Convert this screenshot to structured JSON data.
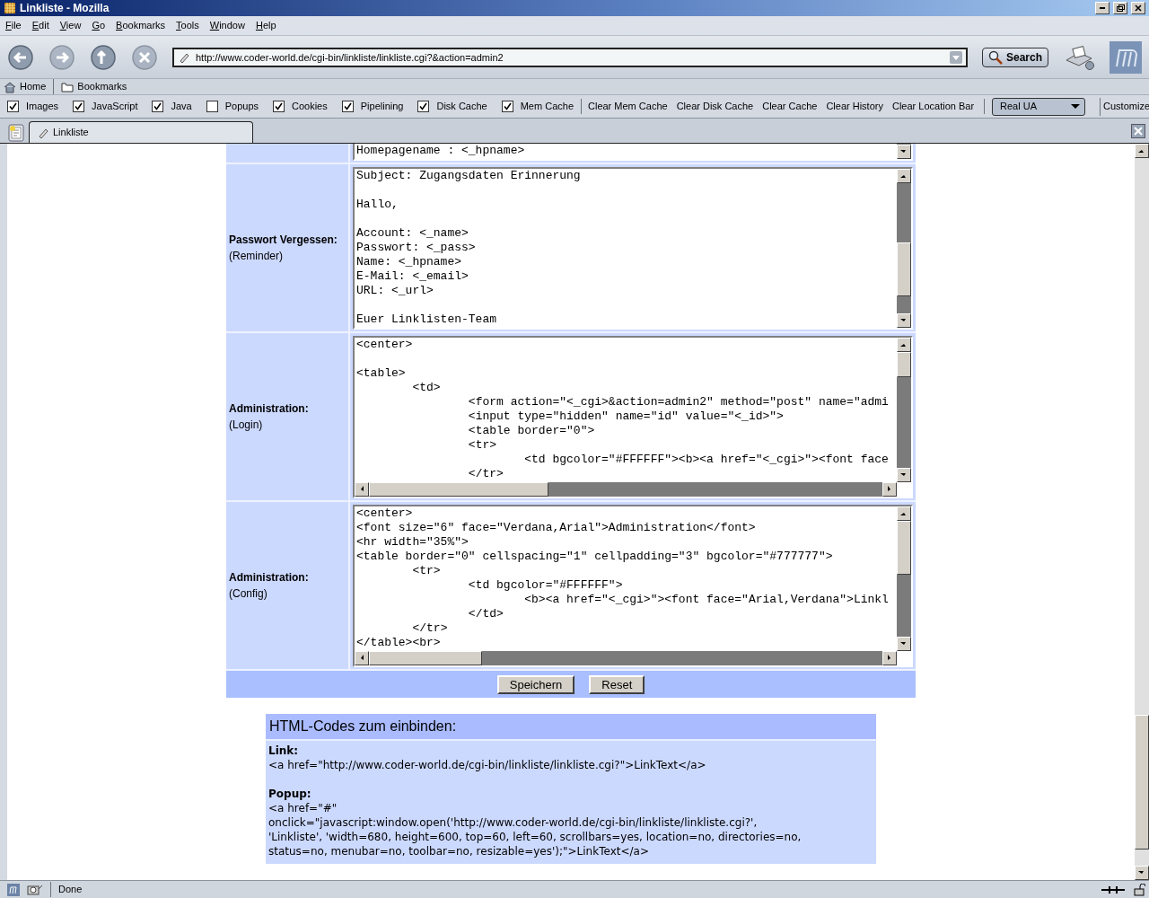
{
  "window": {
    "title": "Linkliste - Mozilla"
  },
  "menu": [
    {
      "label": "File"
    },
    {
      "label": "Edit"
    },
    {
      "label": "View"
    },
    {
      "label": "Go"
    },
    {
      "label": "Bookmarks"
    },
    {
      "label": "Tools"
    },
    {
      "label": "Window"
    },
    {
      "label": "Help"
    }
  ],
  "navigation": {
    "url": "http://www.coder-world.de/cgi-bin/linkliste/linkliste.cgi?&action=admin2",
    "search_button": "Search"
  },
  "personal_bar": [
    {
      "label": "Home",
      "kind": "home"
    },
    {
      "label": "Bookmarks",
      "kind": "folder"
    }
  ],
  "pref_bar": {
    "checkboxes": [
      {
        "label": "Images",
        "checked": true
      },
      {
        "label": "JavaScript",
        "checked": true
      },
      {
        "label": "Java",
        "checked": true
      },
      {
        "label": "Popups",
        "checked": false
      },
      {
        "label": "Cookies",
        "checked": true
      },
      {
        "label": "Pipelining",
        "checked": true
      },
      {
        "label": "Disk Cache",
        "checked": true
      },
      {
        "label": "Mem Cache",
        "checked": true
      }
    ],
    "buttons": [
      "Clear Mem Cache",
      "Clear Disk Cache",
      "Clear Cache",
      "Clear History",
      "Clear Location Bar"
    ],
    "user_agent": "Real UA",
    "customize": "Customize"
  },
  "tabs": [
    {
      "label": "Linkliste",
      "selected": true
    }
  ],
  "form": {
    "rows": [
      {
        "value": "Homepagename : <_hpname>"
      },
      {
        "label": "Passwort Vergessen:",
        "sublabel": "(Reminder)",
        "value": "Subject: Zugangsdaten Erinnerung\n\nHallo,\n\nAccount: <_name>\nPasswort: <_pass>\nName: <_hpname>\nE-Mail: <_email>\nURL: <_url>\n\nEuer Linklisten-Team"
      },
      {
        "label": "Administration:",
        "sublabel": "(Login)",
        "value": "<center>\n\n<table>\n\t<td>\n\t\t<form action=\"<_cgi>&action=admin2\" method=\"post\" name=\"admi\n\t\t<input type=\"hidden\" name=\"id\" value=\"<_id>\">\n\t\t<table border=\"0\">\n\t\t<tr>\n\t\t\t<td bgcolor=\"#FFFFFF\"><b><a href=\"<_cgi>\"><font face\n\t\t</tr>"
      },
      {
        "label": "Administration:",
        "sublabel": "(Config)",
        "value": "<center>\n<font size=\"6\" face=\"Verdana,Arial\">Administration</font>\n<hr width=\"35%\">\n<table border=\"0\" cellspacing=\"1\" cellpadding=\"3\" bgcolor=\"#777777\">\n\t<tr>\n\t\t<td bgcolor=\"#FFFFFF\">\n\t\t\t<b><a href=\"<_cgi>\"><font face=\"Arial,Verdana\">Linkl\n\t\t</td>\n\t</tr>\n</table><br>"
      }
    ],
    "buttons": [
      "Speichern",
      "Reset"
    ]
  },
  "html_codes": {
    "title": "HTML-Codes zum einbinden:",
    "sections": [
      {
        "heading": "Link:",
        "lines": [
          "<a href=\"http://www.coder-world.de/cgi-bin/linkliste/linkliste.cgi?\">LinkText</a>"
        ]
      },
      {
        "heading": "Popup:",
        "lines": [
          "<a href=\"#\"",
          "onclick=\"javascript:window.open('http://www.coder-world.de/cgi-bin/linkliste/linkliste.cgi?',",
          "'Linkliste', 'width=680, height=600, top=60, left=60, scrollbars=yes, location=no, directories=no,",
          "status=no, menubar=no, toolbar=no, resizable=yes');\">LinkText</a>"
        ]
      }
    ]
  },
  "status_bar": {
    "text": "Done"
  }
}
